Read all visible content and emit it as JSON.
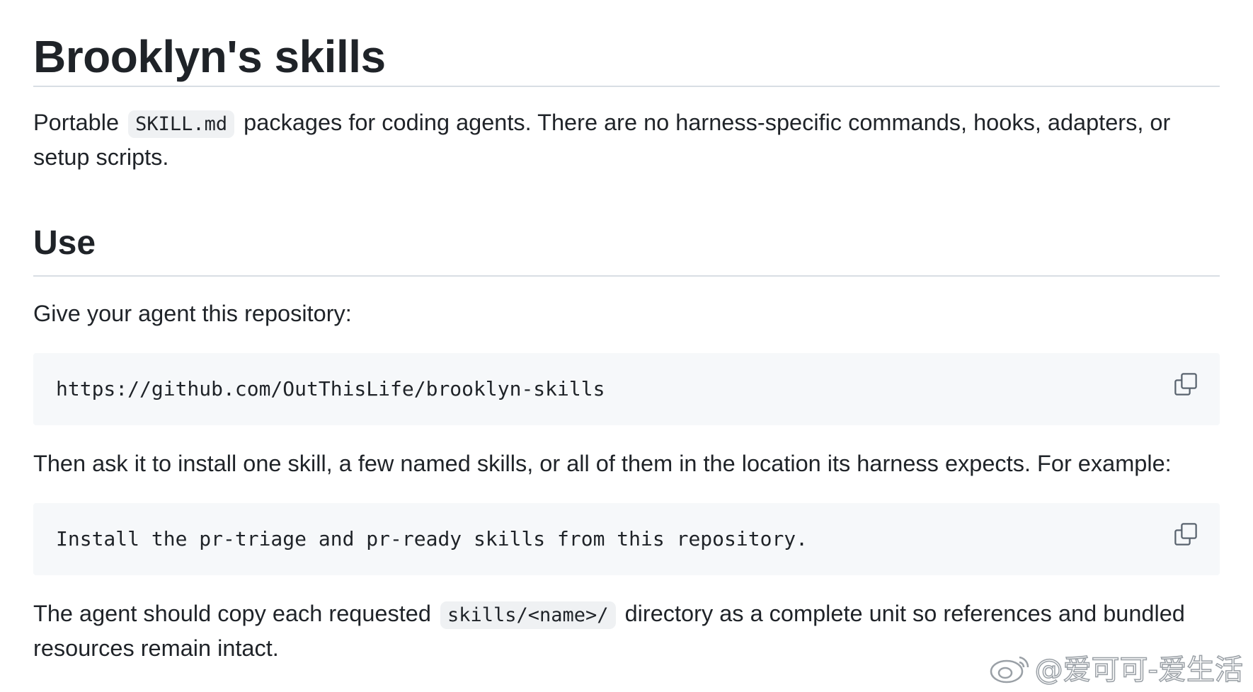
{
  "heading": "Brooklyn's skills",
  "intro": {
    "before": "Portable",
    "code": "SKILL.md",
    "after": "packages for coding agents. There are no harness-specific commands, hooks, adapters, or setup scripts."
  },
  "use_section": {
    "heading": "Use",
    "give_text": "Give your agent this repository:",
    "repo_code": "https://github.com/OutThisLife/brooklyn-skills",
    "then_text": "Then ask it to install one skill, a few named skills, or all of them in the location its harness expects. For example:",
    "example_code": "Install the pr-triage and pr-ready skills from this repository.",
    "copy_note": {
      "before": "The agent should copy each requested",
      "code": "skills/<name>/",
      "after": "directory as a complete unit so references and bundled resources remain intact."
    }
  },
  "copy_icon": "copy-icon",
  "watermark": {
    "icon": "weibo-icon",
    "text": "@爱可可-爱生活"
  }
}
